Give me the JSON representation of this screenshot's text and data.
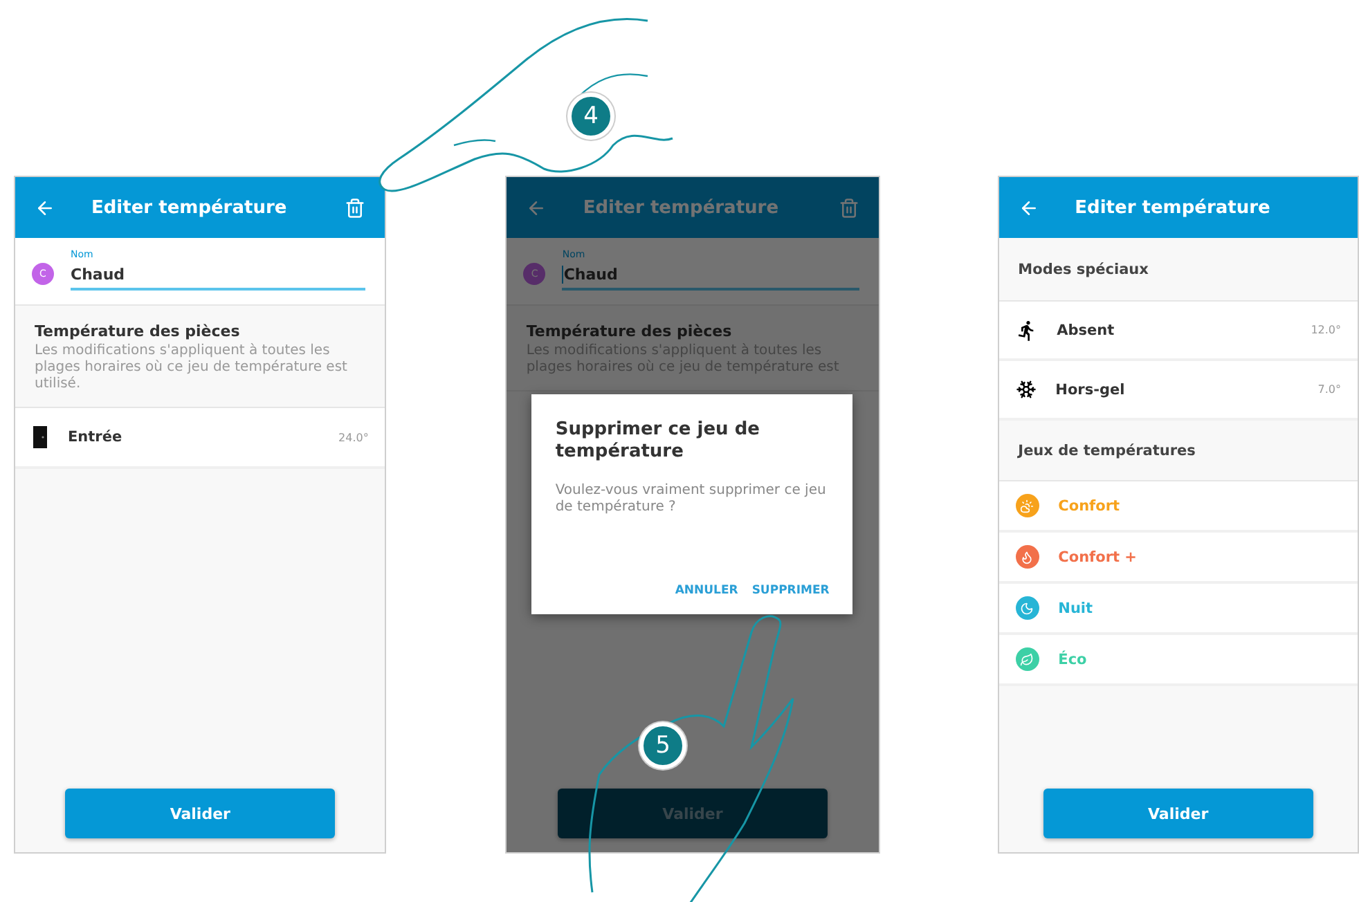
{
  "steps": [
    {
      "label": "4"
    },
    {
      "label": "5"
    }
  ],
  "screens": [
    {
      "kind": "edit",
      "dimmed": false,
      "title": "Editer température",
      "delete_icon": true,
      "name_field": {
        "label": "Nom",
        "avatar": "C",
        "value": "Chaud",
        "focused": false
      },
      "section": {
        "title": "Température des pièces",
        "description": "Les modifications s'appliquent à toutes les plages horaires où ce jeu de température est utilisé."
      },
      "rooms": [
        {
          "name": "Entrée",
          "reading": "24.0°"
        }
      ],
      "button": "Valider"
    },
    {
      "kind": "edit",
      "dimmed": true,
      "title": "Editer température",
      "delete_icon": true,
      "name_field": {
        "label": "Nom",
        "avatar": "C",
        "value": "Chaud",
        "focused": true
      },
      "section": {
        "title": "Température des pièces",
        "description": "Les modifications s'appliquent à toutes les plages horaires où ce jeu de température est"
      },
      "button": "Valider",
      "dialog": {
        "title": "Supprimer ce jeu de température",
        "message": "Voulez-vous vraiment supprimer ce jeu de température ?",
        "actions": [
          "ANNULER",
          "SUPPRIMER"
        ]
      }
    },
    {
      "kind": "list",
      "dimmed": false,
      "title": "Editer température",
      "delete_icon": false,
      "modes_title": "Modes spéciaux",
      "modes": [
        {
          "kind": "away",
          "name": "Absent",
          "reading": "12.0°"
        },
        {
          "kind": "frost",
          "name": "Hors-gel",
          "reading": "7.0°"
        }
      ],
      "sets_title": "Jeux de températures",
      "sets": [
        {
          "kind": "comfort",
          "name": "Confort",
          "color": "#f7a21b"
        },
        {
          "kind": "comfort_plus",
          "name": "Confort +",
          "color": "#f2704a"
        },
        {
          "kind": "night",
          "name": "Nuit",
          "color": "#27b5d6"
        },
        {
          "kind": "eco",
          "name": "Éco",
          "color": "#3dd0a6"
        }
      ],
      "button": "Valider"
    }
  ]
}
